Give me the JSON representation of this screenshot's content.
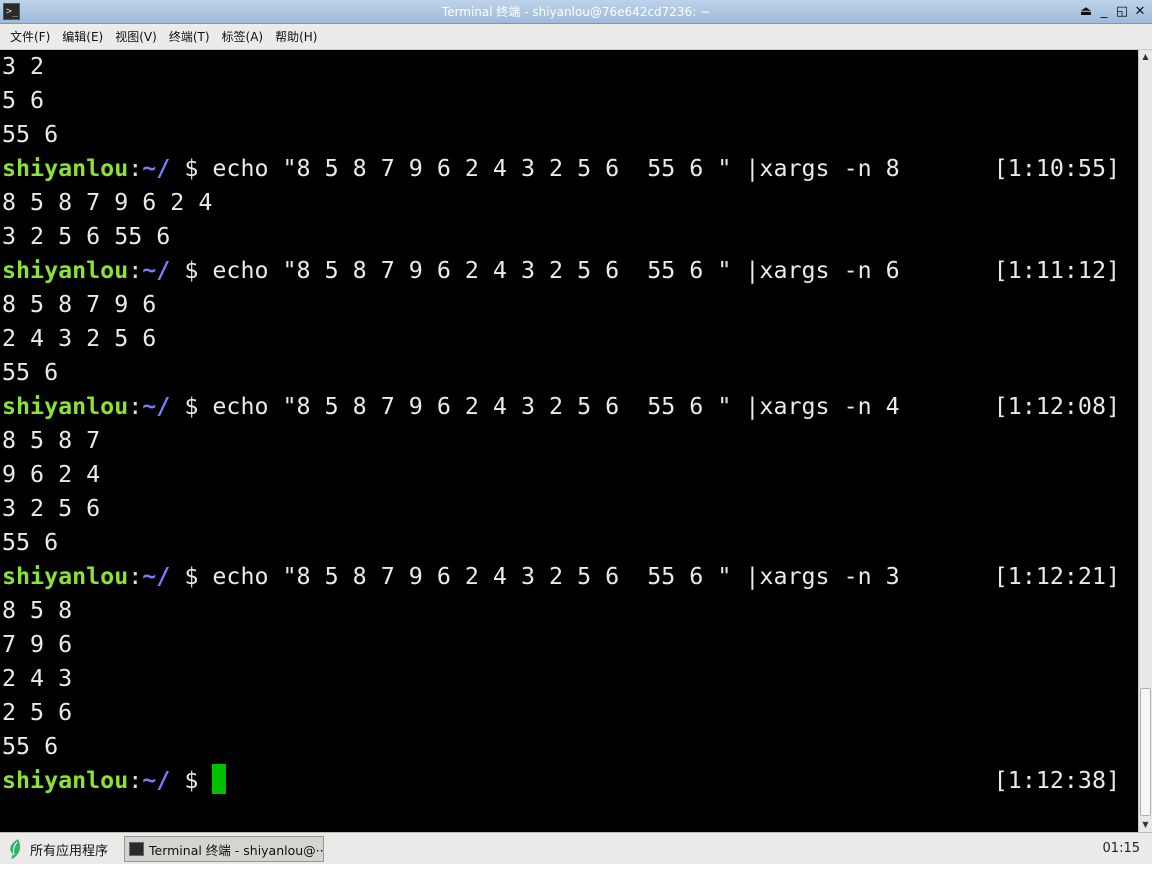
{
  "window": {
    "title": "Terminal 终端 - shiyanlou@76e642cd7236: ~",
    "controls": {
      "shade": "⏏",
      "minimize": "_",
      "maximize": "◱",
      "close": "✕"
    }
  },
  "menu": {
    "items": [
      "文件(F)",
      "编辑(E)",
      "视图(V)",
      "终端(T)",
      "标签(A)",
      "帮助(H)"
    ]
  },
  "terminal": {
    "prompt": {
      "user": "shiyanlou",
      "sep": ":",
      "path": "~/",
      "symbol": " $ "
    },
    "lines": [
      {
        "type": "output",
        "text": "3 2"
      },
      {
        "type": "output",
        "text": "5 6"
      },
      {
        "type": "output",
        "text": "55 6"
      },
      {
        "type": "prompt",
        "command": "echo \"8 5 8 7 9 6 2 4 3 2 5 6  55 6 \" |xargs -n 8",
        "time": "[1:10:55]"
      },
      {
        "type": "output",
        "text": "8 5 8 7 9 6 2 4"
      },
      {
        "type": "output",
        "text": "3 2 5 6 55 6"
      },
      {
        "type": "prompt",
        "command": "echo \"8 5 8 7 9 6 2 4 3 2 5 6  55 6 \" |xargs -n 6",
        "time": "[1:11:12]"
      },
      {
        "type": "output",
        "text": "8 5 8 7 9 6"
      },
      {
        "type": "output",
        "text": "2 4 3 2 5 6"
      },
      {
        "type": "output",
        "text": "55 6"
      },
      {
        "type": "prompt",
        "command": "echo \"8 5 8 7 9 6 2 4 3 2 5 6  55 6 \" |xargs -n 4",
        "time": "[1:12:08]"
      },
      {
        "type": "output",
        "text": "8 5 8 7"
      },
      {
        "type": "output",
        "text": "9 6 2 4"
      },
      {
        "type": "output",
        "text": "3 2 5 6"
      },
      {
        "type": "output",
        "text": "55 6"
      },
      {
        "type": "prompt",
        "command": "echo \"8 5 8 7 9 6 2 4 3 2 5 6  55 6 \" |xargs -n 3",
        "time": "[1:12:21]"
      },
      {
        "type": "output",
        "text": "8 5 8"
      },
      {
        "type": "output",
        "text": "7 9 6"
      },
      {
        "type": "output",
        "text": "2 4 3"
      },
      {
        "type": "output",
        "text": "2 5 6"
      },
      {
        "type": "output",
        "text": "55 6"
      },
      {
        "type": "prompt",
        "command": "",
        "time": "[1:12:38]",
        "cursor": true
      }
    ],
    "colors": {
      "background": "#000000",
      "text": "#eaeaea",
      "user": "#8ae234",
      "path": "#7b7bff",
      "cursor": "#00c000"
    }
  },
  "taskbar": {
    "start_label": "所有应用程序",
    "task_label": "Terminal 终端 - shiyanlou@···",
    "clock": "01:15",
    "start_icon": "shiyanlou-leaf-icon",
    "task_icon": "terminal-icon"
  }
}
